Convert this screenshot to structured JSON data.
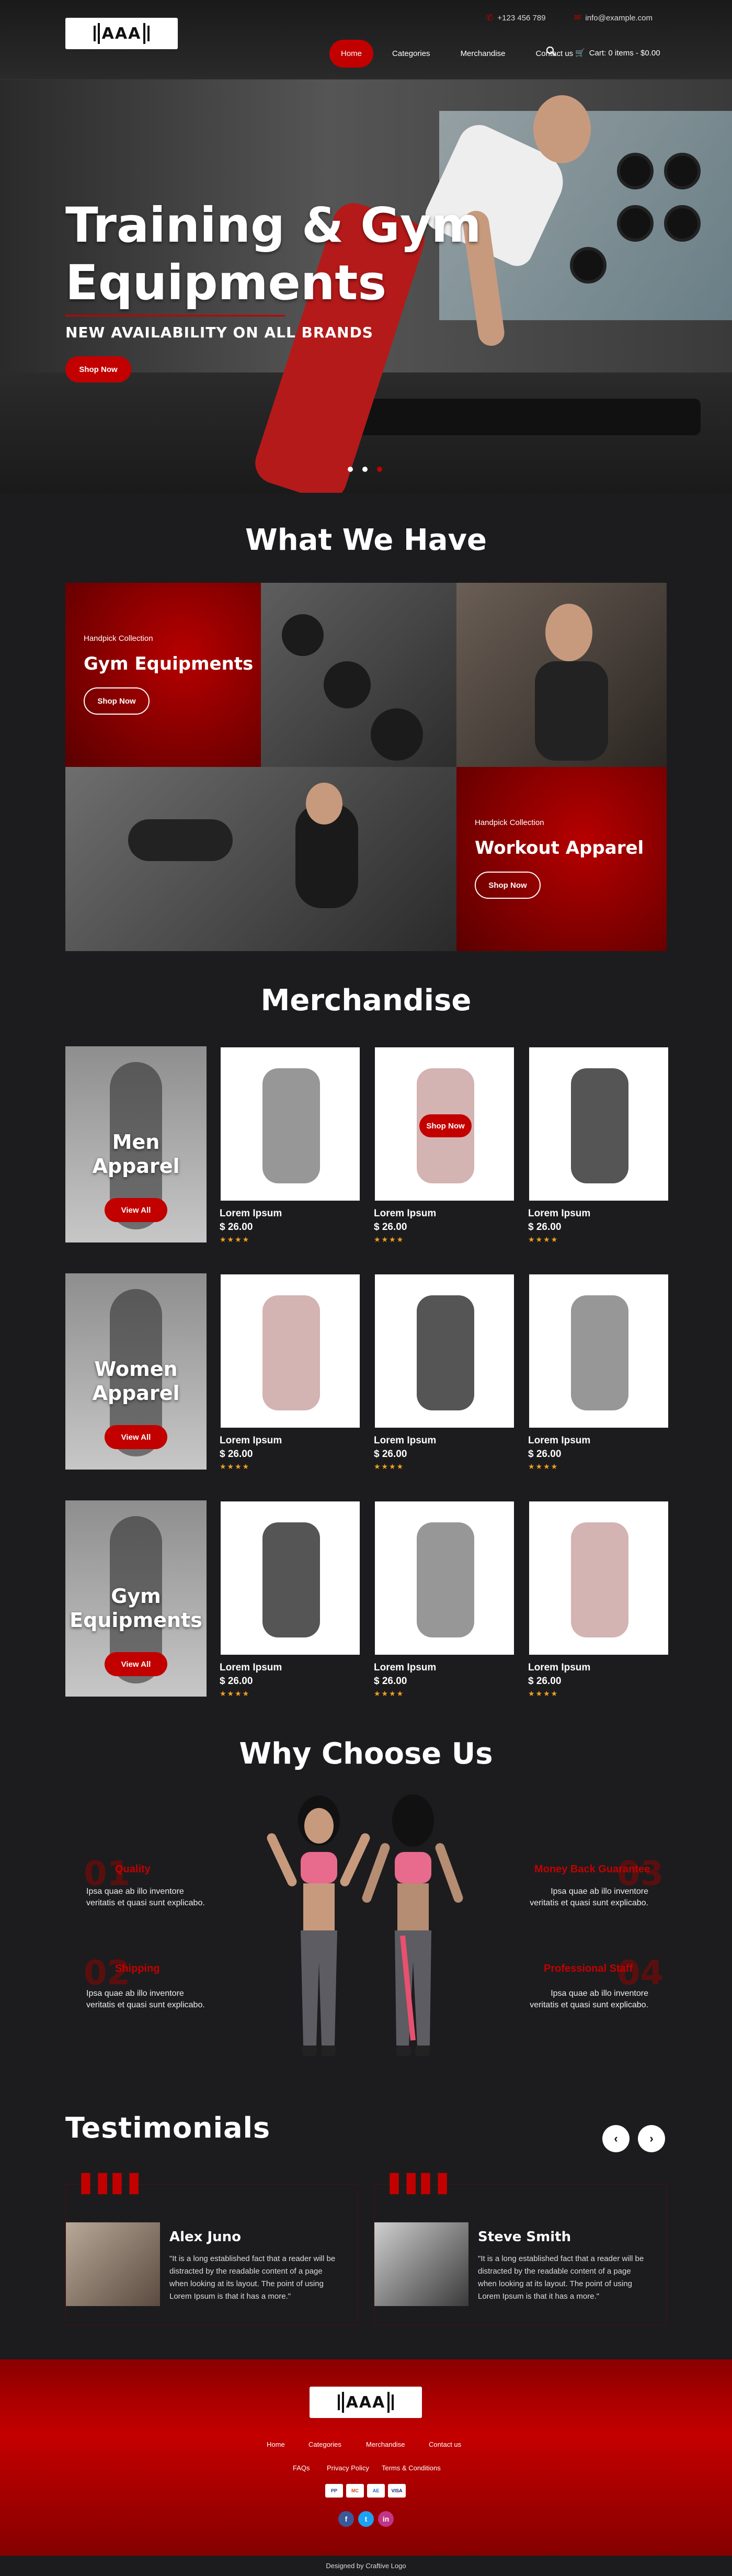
{
  "header": {
    "logo_text": "AAA",
    "phone": "+123 456 789",
    "email": "info@example.com",
    "nav": [
      {
        "label": "Home"
      },
      {
        "label": "Categories"
      },
      {
        "label": "Merchandise"
      },
      {
        "label": "Contact us"
      }
    ],
    "cart_label": "Cart: 0 items - $0.00"
  },
  "hero": {
    "title_line1": "Training & Gym",
    "title_line2": "Equipments",
    "subtitle": "NEW AVAILABILITY ON ALL BRANDS",
    "button": "Shop Now",
    "slides": 3,
    "active_slide": 3
  },
  "what_we_have": {
    "title": "What We Have",
    "tile1": {
      "kicker": "Handpick Collection",
      "title": "Gym Equipments",
      "button": "Shop Now"
    },
    "tile2": {
      "kicker": "Handpick Collection",
      "title": "Workout Apparel",
      "button": "Shop Now"
    }
  },
  "merchandise": {
    "title": "Merchandise",
    "rows": [
      {
        "category_line1": "Men",
        "category_line2": "Apparel",
        "button": "View All",
        "products": [
          {
            "name": "Lorem Ipsum",
            "price": "$ 26.00",
            "rating": 4
          },
          {
            "name": "Lorem Ipsum",
            "price": "$ 26.00",
            "rating": 4,
            "hover_button": "Shop Now"
          },
          {
            "name": "Lorem Ipsum",
            "price": "$ 26.00",
            "rating": 4
          }
        ]
      },
      {
        "category_line1": "Women",
        "category_line2": "Apparel",
        "button": "View All",
        "products": [
          {
            "name": "Lorem Ipsum",
            "price": "$ 26.00",
            "rating": 4
          },
          {
            "name": "Lorem Ipsum",
            "price": "$ 26.00",
            "rating": 4
          },
          {
            "name": "Lorem Ipsum",
            "price": "$ 26.00",
            "rating": 4
          }
        ]
      },
      {
        "category_line1": "Gym",
        "category_line2": "Equipments",
        "button": "View All",
        "products": [
          {
            "name": "Lorem Ipsum",
            "price": "$ 26.00",
            "rating": 4
          },
          {
            "name": "Lorem Ipsum",
            "price": "$ 26.00",
            "rating": 4
          },
          {
            "name": "Lorem Ipsum",
            "price": "$ 26.00",
            "rating": 4
          }
        ]
      }
    ],
    "star_glyph": "★★★★"
  },
  "why_choose": {
    "title": "Why Choose Us",
    "features": [
      {
        "num": "01",
        "title": "Quality",
        "text_line1": "Ipsa quae ab illo inventore",
        "text_line2": "veritatis et quasi sunt explicabo."
      },
      {
        "num": "02",
        "title": "Shipping",
        "text_line1": "Ipsa quae ab illo inventore",
        "text_line2": "veritatis et quasi sunt explicabo."
      },
      {
        "num": "03",
        "title": "Money Back Guarantee",
        "text_line1": "Ipsa quae ab illo inventore",
        "text_line2": "veritatis et quasi sunt explicabo."
      },
      {
        "num": "04",
        "title": "Professional Staff",
        "text_line1": "Ipsa quae ab illo inventore",
        "text_line2": "veritatis et quasi sunt explicabo."
      }
    ]
  },
  "testimonials": {
    "title": "Testimonials",
    "items": [
      {
        "name": "Alex Juno",
        "text": "\"It is a long established fact that a reader will be distracted by the readable content of a page when looking at its layout. The point of using Lorem Ipsum is that it has a more.\""
      },
      {
        "name": "Steve Smith",
        "text": "\"It is a long established fact that a reader will be distracted by the readable content of a page when looking at its layout. The point of using Lorem Ipsum is that it has a more.\""
      }
    ],
    "prev_icon": "‹",
    "next_icon": "›"
  },
  "footer": {
    "links_row1": [
      "Home",
      "Categories",
      "Merchandise",
      "Contact us"
    ],
    "links_row2": [
      "FAQs",
      "Privacy Policy",
      "Terms & Conditions"
    ],
    "payments": [
      "PP",
      "MC",
      "AE",
      "VISA"
    ],
    "social": [
      "f",
      "t",
      "in"
    ],
    "credit": "Designed by Craftive Logo"
  },
  "colors": {
    "accent": "#c30000",
    "background": "#1c1c1e"
  }
}
